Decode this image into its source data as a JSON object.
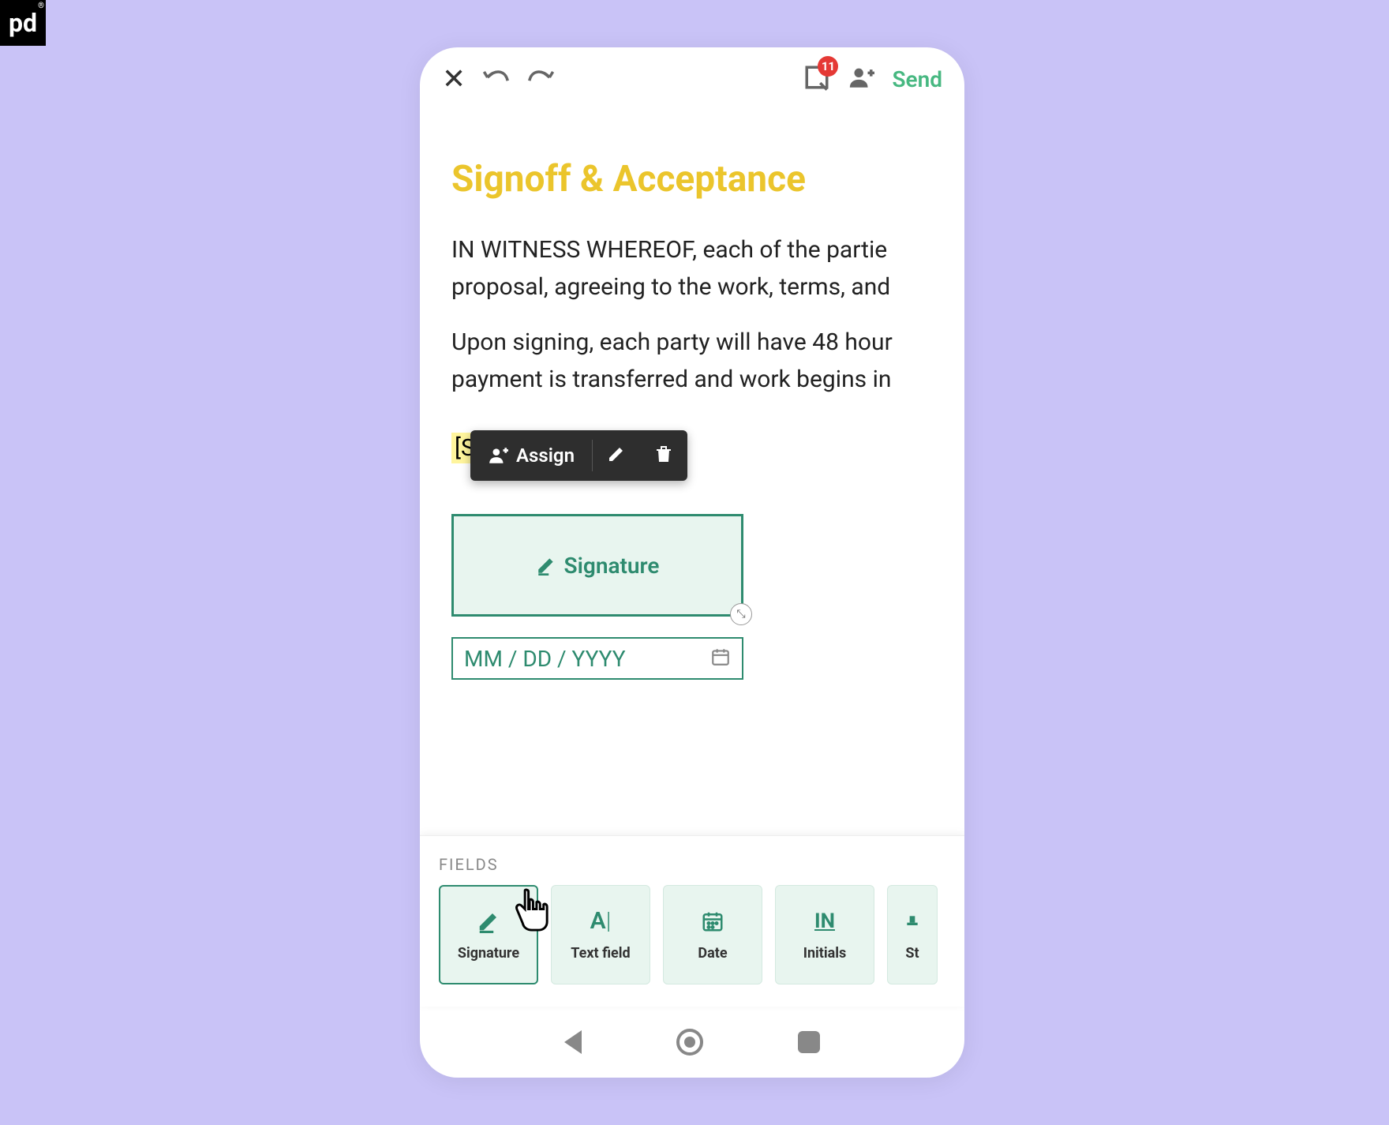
{
  "brand": {
    "logo_text": "pd"
  },
  "toolbar": {
    "badge_count": "11",
    "send_label": "Send"
  },
  "document": {
    "heading": "Signoff & Acceptance",
    "para1": "IN WITNESS WHEREOF, each of the partie proposal, agreeing to the work, terms, and",
    "para2": "Upon signing, each party will have 48 hour payment is transferred and work begins in",
    "highlighted_tag": "[Sender Company]",
    "signature_label": "Signature",
    "date_placeholder": "MM / DD / YYYY"
  },
  "context_menu": {
    "assign_label": "Assign"
  },
  "fields_panel": {
    "title": "FIELDS",
    "items": [
      {
        "label": "Signature",
        "icon": "signature"
      },
      {
        "label": "Text field",
        "icon": "text"
      },
      {
        "label": "Date",
        "icon": "date"
      },
      {
        "label": "Initials",
        "icon": "initials"
      },
      {
        "label": "St",
        "icon": "stamp"
      }
    ]
  }
}
